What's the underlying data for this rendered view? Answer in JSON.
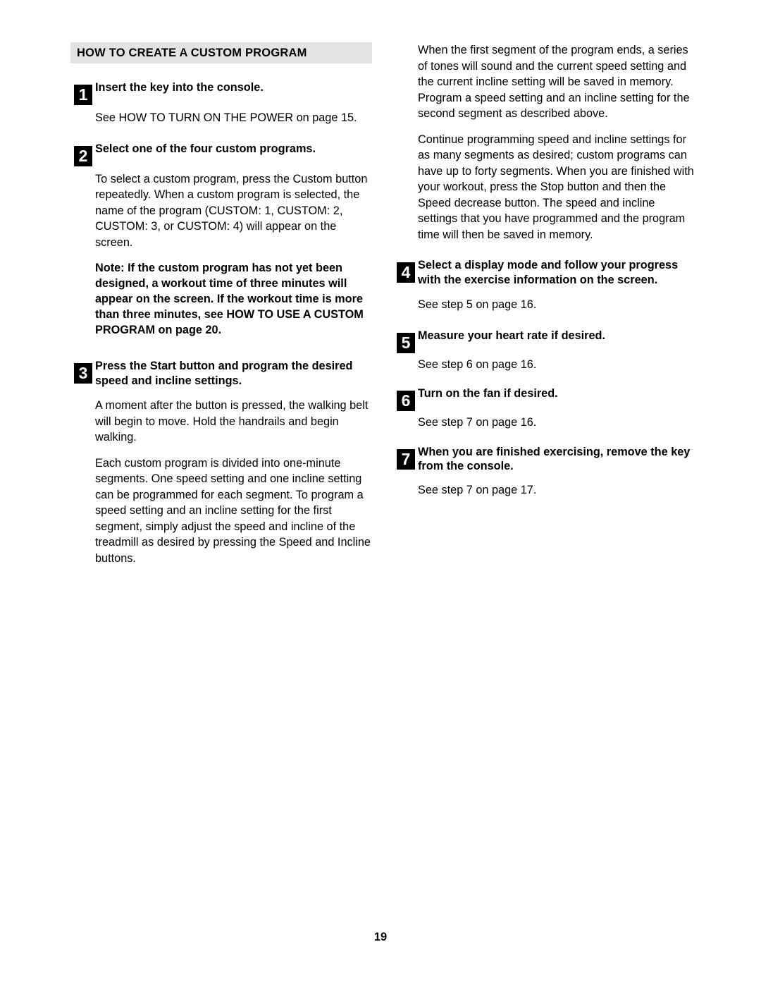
{
  "document": {
    "page_number": "19",
    "section_heading": "HOW TO CREATE A CUSTOM PROGRAM"
  },
  "left_column": {
    "steps": [
      {
        "number": "1",
        "title": "Insert the key into the console.",
        "body": "See HOW TO TURN ON THE POWER on page 15."
      },
      {
        "number": "2",
        "title": "Select one of the four custom programs.",
        "body": "To select a custom program, press the Custom button repeatedly. When a custom program is selected, the name of the program (CUSTOM: 1, CUSTOM: 2, CUSTOM: 3, or CUSTOM: 4) will appear on the screen.",
        "note": "Note: If the custom program has not yet been designed, a workout time of three minutes will appear on the screen. If the workout time is more than three minutes, see HOW TO USE A CUSTOM PROGRAM on page 20."
      },
      {
        "number": "3",
        "title": "Press the Start button and program the desired speed and incline settings.",
        "body": "A moment after the button is pressed, the walking belt will begin to move. Hold the handrails and begin walking.",
        "body2": "Each custom program is divided into one-minute segments. One speed setting and one incline setting can be programmed for each segment. To program a speed setting and an incline setting for the first segment, simply adjust the speed and incline of the treadmill as desired by pressing the Speed and Incline buttons."
      }
    ]
  },
  "right_column": {
    "intro_paragraphs": [
      "When the first segment of the program ends, a series of tones will sound and the current speed setting and the current incline setting will be saved in memory. Program a speed setting and an incline setting for the second segment as described above.",
      "Continue programming speed and incline settings for as many segments as desired; custom programs can have up to forty segments. When you are finished with your workout, press the Stop button and then the Speed decrease button. The speed and incline settings that you have programmed and the program time will then be saved in memory."
    ],
    "steps": [
      {
        "number": "4",
        "title": "Select a display mode and follow your progress with the exercise information on the screen.",
        "body": "See step 5 on page 16."
      },
      {
        "number": "5",
        "title": "Measure your heart rate if desired.",
        "body": "See step 6 on page 16."
      },
      {
        "number": "6",
        "title": "Turn on the fan if desired.",
        "body": "See step 7 on page 16."
      },
      {
        "number": "7",
        "title": "When you are finished exercising, remove the key from the console.",
        "body": "See step 7 on page 17."
      }
    ]
  }
}
